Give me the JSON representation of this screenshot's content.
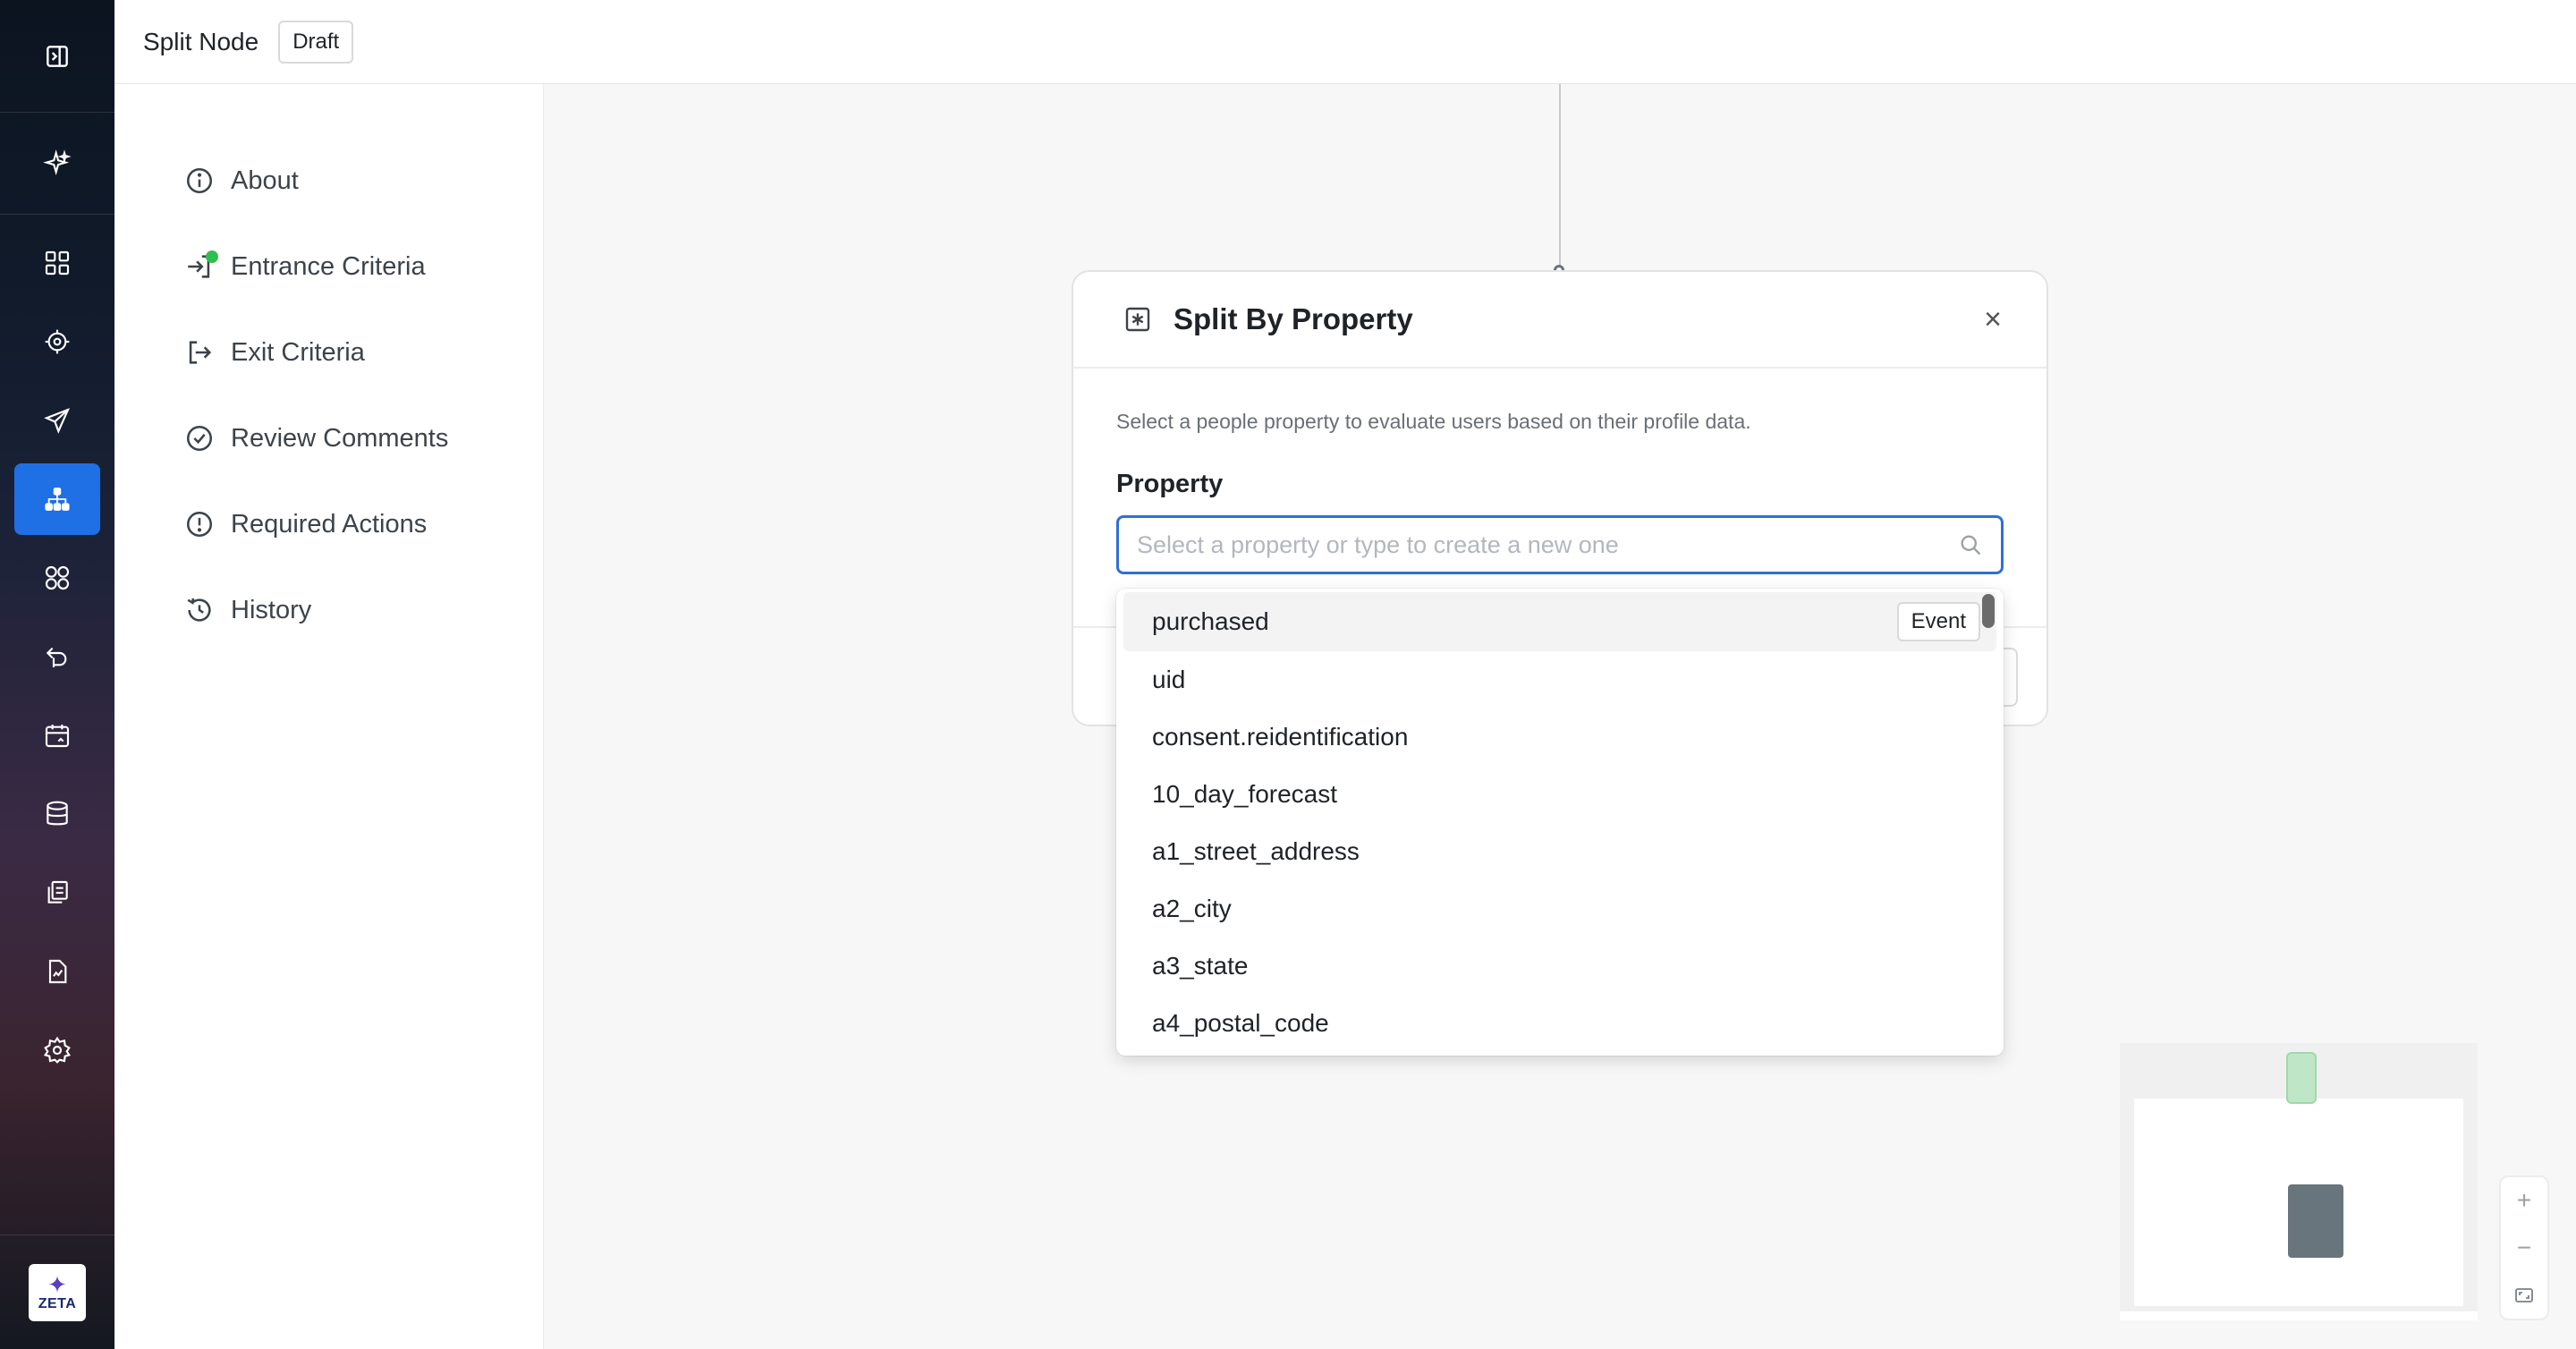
{
  "header": {
    "title": "Split Node",
    "status_badge": "Draft"
  },
  "rail": {
    "logo_text": "ZETA",
    "items": [
      {
        "icon": "dashboard-icon"
      },
      {
        "icon": "target-icon"
      },
      {
        "icon": "send-icon"
      },
      {
        "icon": "journey-tree-icon",
        "active": true
      },
      {
        "icon": "segments-icon"
      },
      {
        "icon": "recall-icon"
      },
      {
        "icon": "calendar-icon"
      },
      {
        "icon": "database-icon"
      },
      {
        "icon": "library-icon"
      },
      {
        "icon": "report-icon"
      },
      {
        "icon": "settings-icon"
      }
    ]
  },
  "subnav": {
    "items": [
      {
        "label": "About",
        "icon": "info-icon"
      },
      {
        "label": "Entrance Criteria",
        "icon": "entrance-icon",
        "indicator": "green"
      },
      {
        "label": "Exit Criteria",
        "icon": "exit-icon"
      },
      {
        "label": "Review Comments",
        "icon": "check-circle-icon"
      },
      {
        "label": "Required Actions",
        "icon": "alert-circle-icon"
      },
      {
        "label": "History",
        "icon": "history-icon"
      }
    ]
  },
  "card": {
    "title": "Split By Property",
    "description": "Select a people property to evaluate users based on their profile data.",
    "field_label": "Property",
    "input_placeholder": "Select a property or type to create a new one",
    "input_value": ""
  },
  "dropdown": {
    "options": [
      {
        "label": "purchased",
        "tag": "Event"
      },
      {
        "label": "uid"
      },
      {
        "label": "consent.reidentification"
      },
      {
        "label": "10_day_forecast"
      },
      {
        "label": "a1_street_address"
      },
      {
        "label": "a2_city"
      },
      {
        "label": "a3_state"
      },
      {
        "label": "a4_postal_code"
      }
    ]
  },
  "colors": {
    "accent": "#1f6fe5",
    "focus_border": "#2f6fd8",
    "success_dot": "#2fbf4c"
  }
}
